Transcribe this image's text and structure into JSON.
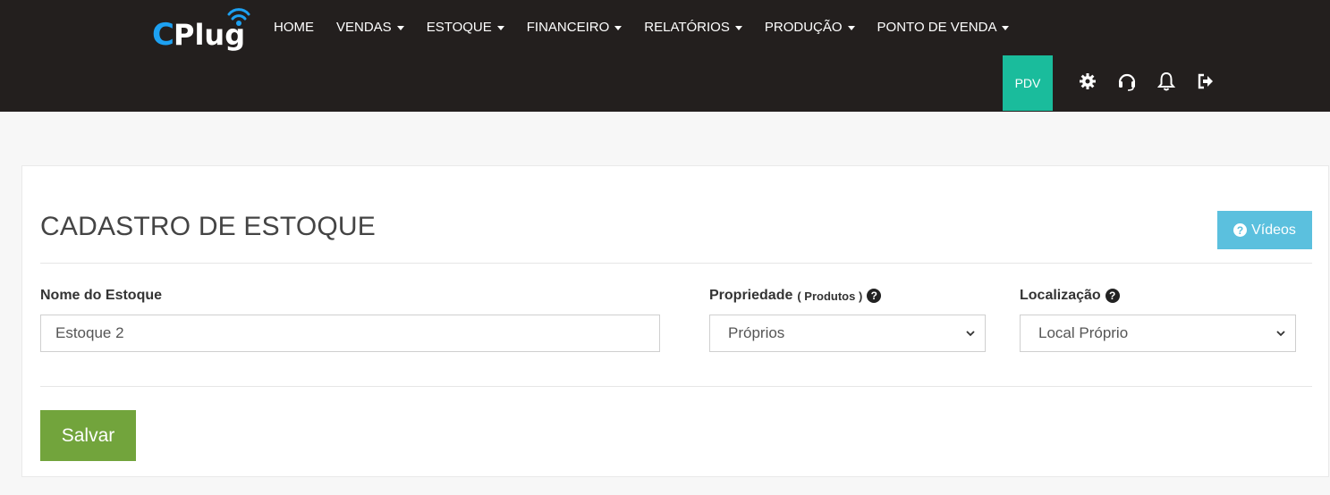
{
  "header": {
    "logo_text": "CPlug",
    "nav": [
      {
        "label": "HOME",
        "dropdown": false
      },
      {
        "label": "VENDAS",
        "dropdown": true
      },
      {
        "label": "ESTOQUE",
        "dropdown": true
      },
      {
        "label": "FINANCEIRO",
        "dropdown": true
      },
      {
        "label": "RELATÓRIOS",
        "dropdown": true
      },
      {
        "label": "PRODUÇÃO",
        "dropdown": true
      },
      {
        "label": "PONTO DE VENDA",
        "dropdown": true
      }
    ],
    "pdv_label": "PDV",
    "icons": [
      "gear-icon",
      "headset-icon",
      "bell-icon",
      "logout-icon"
    ],
    "pdv_color": "#1abc9c",
    "bar_color": "#231f1e"
  },
  "page": {
    "title": "CADASTRO DE ESTOQUE",
    "videos_label": "Vídeos",
    "fields": {
      "nome": {
        "label": "Nome do Estoque",
        "value": "Estoque 2"
      },
      "propriedade": {
        "label": "Propriedade",
        "hint": "( Produtos )",
        "selected": "Próprios"
      },
      "localizacao": {
        "label": "Localização",
        "selected": "Local Próprio"
      }
    },
    "save_label": "Salvar",
    "save_color": "#72a43c",
    "videos_color": "#5bc0de"
  }
}
